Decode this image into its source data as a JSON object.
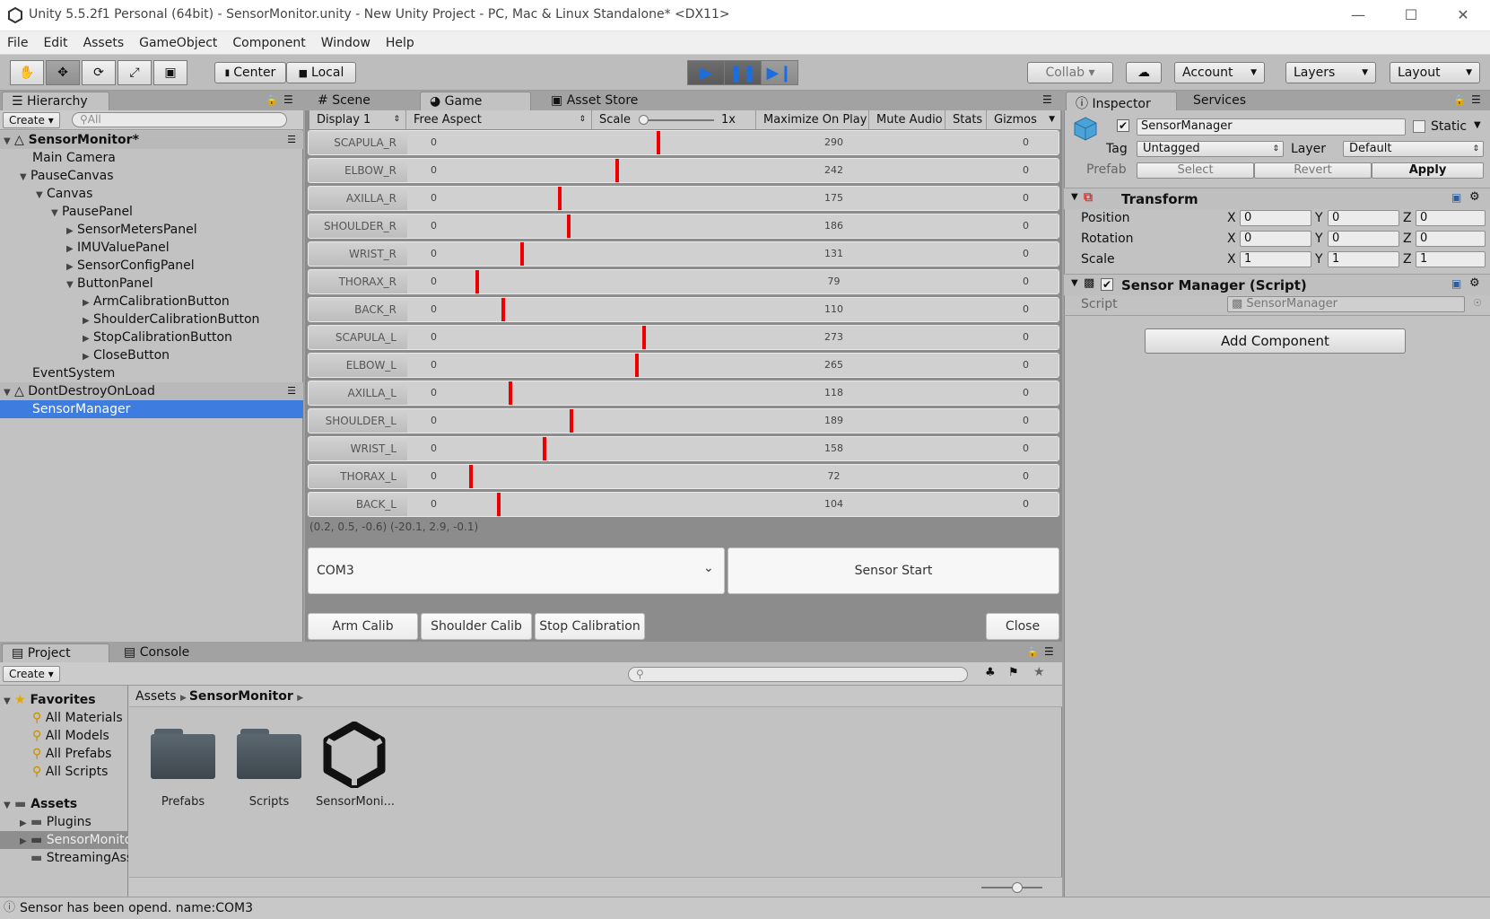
{
  "window": {
    "title": "Unity 5.5.2f1 Personal (64bit) - SensorMonitor.unity - New Unity Project - PC, Mac & Linux Standalone* <DX11>",
    "minimize": "—",
    "maximize": "☐",
    "close": "✕"
  },
  "menu": [
    "File",
    "Edit",
    "Assets",
    "GameObject",
    "Component",
    "Window",
    "Help"
  ],
  "toolbar": {
    "center": "Center",
    "local": "Local",
    "collab": "Collab ▾",
    "account": "Account",
    "layers": "Layers",
    "layout": "Layout"
  },
  "hierarchy": {
    "tab": "Hierarchy",
    "create": "Create ▾",
    "search_placeholder": "All",
    "rows": [
      {
        "text": "SensorMonitor*"
      },
      {
        "text": "Main Camera"
      },
      {
        "text": "PauseCanvas"
      },
      {
        "text": "Canvas"
      },
      {
        "text": "PausePanel"
      },
      {
        "text": "SensorMetersPanel"
      },
      {
        "text": "IMUValuePanel"
      },
      {
        "text": "SensorConfigPanel"
      },
      {
        "text": "ButtonPanel"
      },
      {
        "text": "ArmCalibrationButton"
      },
      {
        "text": "ShoulderCalibrationButton"
      },
      {
        "text": "StopCalibrationButton"
      },
      {
        "text": "CloseButton"
      },
      {
        "text": "EventSystem"
      },
      {
        "text": "DontDestroyOnLoad"
      },
      {
        "text": "SensorManager"
      }
    ]
  },
  "game": {
    "tabs": {
      "scene": "Scene",
      "game": "Game",
      "asset_store": "Asset Store"
    },
    "toolbar": {
      "display": "Display 1",
      "aspect": "Free Aspect",
      "scale": "Scale",
      "scale_value": "1x",
      "maximize": "Maximize On Play",
      "mute": "Mute Audio",
      "stats": "Stats",
      "gizmos": "Gizmos"
    },
    "range_max": 1000,
    "meters": [
      {
        "label": "SCAPULA_R",
        "min": "0",
        "value": 290,
        "value_text": "290",
        "right": "0"
      },
      {
        "label": "ELBOW_R",
        "min": "0",
        "value": 242,
        "value_text": "242",
        "right": "0"
      },
      {
        "label": "AXILLA_R",
        "min": "0",
        "value": 175,
        "value_text": "175",
        "right": "0"
      },
      {
        "label": "SHOULDER_R",
        "min": "0",
        "value": 186,
        "value_text": "186",
        "right": "0"
      },
      {
        "label": "WRIST_R",
        "min": "0",
        "value": 131,
        "value_text": "131",
        "right": "0"
      },
      {
        "label": "THORAX_R",
        "min": "0",
        "value": 79,
        "value_text": "79",
        "right": "0"
      },
      {
        "label": "BACK_R",
        "min": "0",
        "value": 110,
        "value_text": "110",
        "right": "0"
      },
      {
        "label": "SCAPULA_L",
        "min": "0",
        "value": 273,
        "value_text": "273",
        "right": "0"
      },
      {
        "label": "ELBOW_L",
        "min": "0",
        "value": 265,
        "value_text": "265",
        "right": "0"
      },
      {
        "label": "AXILLA_L",
        "min": "0",
        "value": 118,
        "value_text": "118",
        "right": "0"
      },
      {
        "label": "SHOULDER_L",
        "min": "0",
        "value": 189,
        "value_text": "189",
        "right": "0"
      },
      {
        "label": "WRIST_L",
        "min": "0",
        "value": 158,
        "value_text": "158",
        "right": "0"
      },
      {
        "label": "THORAX_L",
        "min": "0",
        "value": 72,
        "value_text": "72",
        "right": "0"
      },
      {
        "label": "BACK_L",
        "min": "0",
        "value": 104,
        "value_text": "104",
        "right": "0"
      }
    ],
    "imu_text": "(0.2, 0.5, -0.6) (-20.1, 2.9, -0.1)",
    "port": "COM3",
    "sensor_start": "Sensor Start",
    "arm_calib": "Arm Calib",
    "shoulder_calib": "Shoulder Calib",
    "stop_calibration": "Stop Calibration",
    "close": "Close"
  },
  "inspector": {
    "tab": "Inspector",
    "services_tab": "Services",
    "object_name": "SensorManager",
    "static": "Static",
    "tag_label": "Tag",
    "tag_value": "Untagged",
    "layer_label": "Layer",
    "layer_value": "Default",
    "prefab_label": "Prefab",
    "prefab_select": "Select",
    "prefab_revert": "Revert",
    "prefab_apply": "Apply",
    "transform_title": "Transform",
    "position_label": "Position",
    "rotation_label": "Rotation",
    "scale_label": "Scale",
    "axis_x": "X",
    "axis_y": "Y",
    "axis_z": "Z",
    "position": [
      "0",
      "0",
      "0"
    ],
    "rotation": [
      "0",
      "0",
      "0"
    ],
    "scale": [
      "1",
      "1",
      "1"
    ],
    "script_component": "Sensor Manager (Script)",
    "script_label": "Script",
    "script_value": "SensorManager",
    "add_component": "Add Component"
  },
  "project": {
    "tab": "Project",
    "console_tab": "Console",
    "create": "Create ▾",
    "favorites": "Favorites",
    "favorite_items": [
      "All Materials",
      "All Models",
      "All Prefabs",
      "All Scripts"
    ],
    "assets": "Assets",
    "asset_folders": [
      "Plugins",
      "SensorMonitor",
      "StreamingAssets"
    ],
    "breadcrumb_root": "Assets",
    "breadcrumb_current": "SensorMonitor",
    "items": [
      "Prefabs",
      "Scripts",
      "SensorMoni..."
    ]
  },
  "status": "Sensor has been opend. name:COM3",
  "colors": {
    "accent": "#3e7ce0",
    "meter_marker": "#ee0000",
    "play_blue": "#1c6ee0"
  }
}
